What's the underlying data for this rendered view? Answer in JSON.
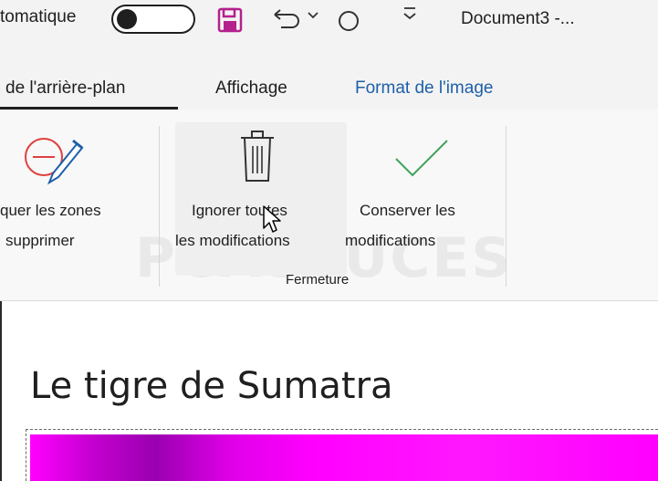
{
  "titlebar": {
    "autosave_label": "tomatique",
    "document_title": "Document3 -..."
  },
  "tabs": [
    {
      "label": "de l'arrière-plan",
      "active": true
    },
    {
      "label": "Affichage",
      "active": false
    },
    {
      "label": "Format de l'image",
      "active": false
    }
  ],
  "ribbon": {
    "mark_remove": {
      "line1": "quer les zones",
      "line2": "supprimer"
    },
    "discard_all": {
      "line1": "Ignorer toutes",
      "line2": "les modifications"
    },
    "keep_changes": {
      "line1": "Conserver les",
      "line2": "modifications"
    },
    "group_label": "Fermeture",
    "watermark": "PCASTUCES"
  },
  "document": {
    "heading": "Le tigre de Sumatra"
  },
  "colors": {
    "accent_blue": "#1e5fa8",
    "check_green": "#3fa35a",
    "save_magenta": "#b4208c",
    "eraser_red": "#e04040",
    "image_magenta": "#ff00ff"
  }
}
